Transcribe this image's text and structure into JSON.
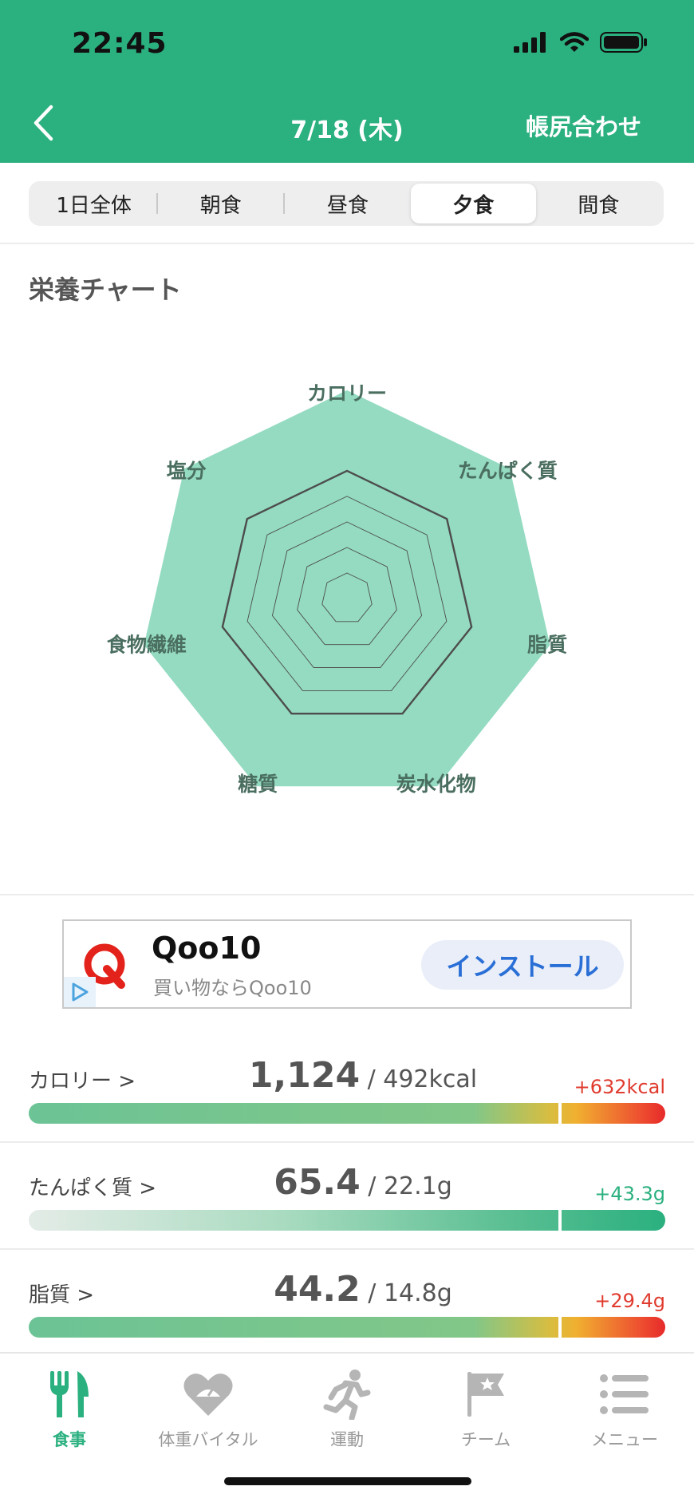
{
  "status_bar": {
    "time": "22:45"
  },
  "nav": {
    "title": "7/18 (木)",
    "action": "帳尻合わせ"
  },
  "segments": [
    {
      "label": "1日全体",
      "active": false
    },
    {
      "label": "朝食",
      "active": false
    },
    {
      "label": "昼食",
      "active": false
    },
    {
      "label": "夕食",
      "active": true
    },
    {
      "label": "間食",
      "active": false
    }
  ],
  "chart_section": {
    "title": "栄養チャート"
  },
  "chart_data": {
    "type": "radar",
    "axes": [
      "カロリー",
      "たんぱく質",
      "脂質",
      "炭水化物",
      "糖質",
      "食物繊維",
      "塩分"
    ],
    "grid_levels": 5,
    "target_ring": 1.0,
    "axis_max": 1.5,
    "values": [
      1.5,
      1.5,
      1.5,
      1.5,
      1.5,
      1.5,
      1.5
    ],
    "fill_color": "#94dbc1",
    "line_color": "#4d4d4d"
  },
  "ad": {
    "title": "Qoo10",
    "subtitle": "買い物ならQoo10",
    "install_label": "インストール"
  },
  "nutrients": [
    {
      "label": "カロリー >",
      "value": "1,124",
      "target": " / 492kcal",
      "diff": "+632kcal",
      "diff_color": "#e03b2e",
      "bar": "over"
    },
    {
      "label": "たんぱく質 >",
      "value": "65.4",
      "target": " / 22.1g",
      "diff": "+43.3g",
      "diff_color": "#2bb07f",
      "bar": "good"
    },
    {
      "label": "脂質 >",
      "value": "44.2",
      "target": " / 14.8g",
      "diff": "+29.4g",
      "diff_color": "#e03b2e",
      "bar": "over"
    }
  ],
  "tabs": [
    {
      "label": "食事",
      "icon": "fork-knife-icon",
      "active": true
    },
    {
      "label": "体重バイタル",
      "icon": "heart-scale-icon",
      "active": false
    },
    {
      "label": "運動",
      "icon": "running-icon",
      "active": false
    },
    {
      "label": "チーム",
      "icon": "flag-icon",
      "active": false
    },
    {
      "label": "メニュー",
      "icon": "list-menu-icon",
      "active": false
    }
  ],
  "colors": {
    "brand": "#2bb07f",
    "over": "#e03b2e"
  }
}
